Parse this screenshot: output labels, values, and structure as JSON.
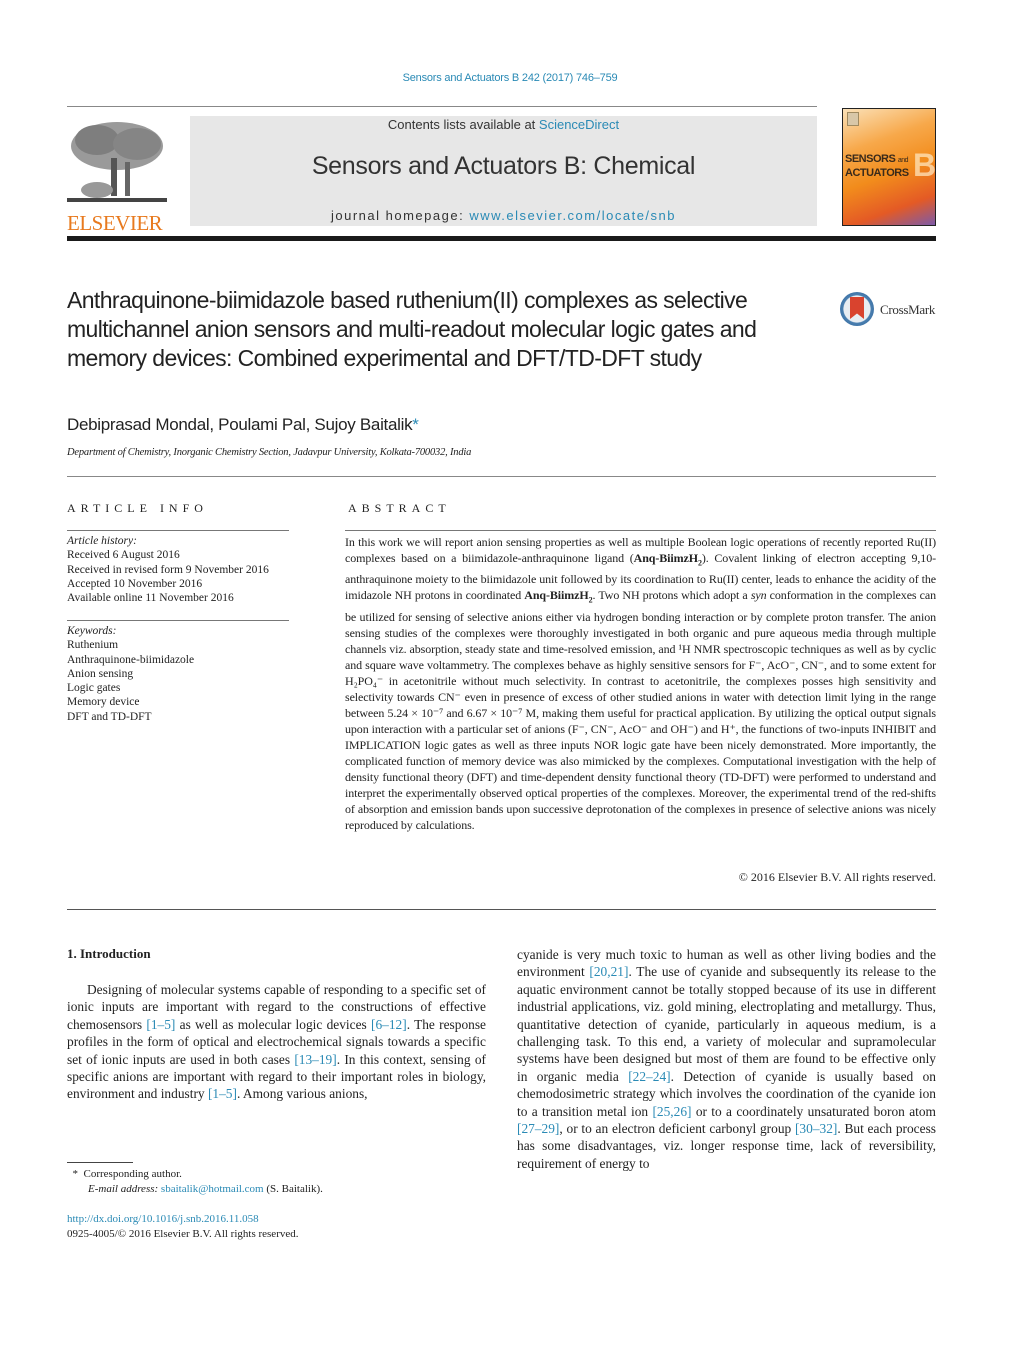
{
  "header": {
    "journal_ref": "Sensors and Actuators B 242 (2017) 746–759",
    "contents_prefix": "Contents lists available at ",
    "contents_link": "ScienceDirect",
    "journal_title": "Sensors and Actuators B: Chemical",
    "homepage_prefix": "journal homepage: ",
    "homepage_link": "www.elsevier.com/locate/snb",
    "publisher_logo_text": "ELSEVIER",
    "cover": {
      "line1": "SENSORS",
      "line1_small": "and",
      "line2": "ACTUATORS",
      "letter": "B"
    },
    "colors": {
      "link": "#2a8ab5",
      "elsevier_orange": "#e87a1f",
      "masthead_bg": "#e7e7e7"
    }
  },
  "article": {
    "title": "Anthraquinone-biimidazole based ruthenium(II) complexes as selective multichannel anion sensors and multi-readout molecular logic gates and memory devices: Combined experimental and DFT/TD-DFT study",
    "crossmark_label": "CrossMark",
    "authors": "Debiprasad Mondal, Poulami Pal, Sujoy Baitalik",
    "author_mark": "*",
    "affiliation": "Department of Chemistry, Inorganic Chemistry Section, Jadavpur University, Kolkata-700032, India"
  },
  "article_info": {
    "heading": "ARTICLE INFO",
    "history_label": "Article history:",
    "history": [
      "Received 6 August 2016",
      "Received in revised form 9 November 2016",
      "Accepted 10 November 2016",
      "Available online 11 November 2016"
    ],
    "keywords_label": "Keywords:",
    "keywords": [
      "Ruthenium",
      "Anthraquinone-biimidazole",
      "Anion sensing",
      "Logic gates",
      "Memory device",
      "DFT and TD-DFT"
    ]
  },
  "abstract": {
    "heading": "ABSTRACT",
    "p1": "In this work we will report anion sensing properties as well as multiple Boolean logic operations of recently reported Ru(II) complexes based on a biimidazole-anthraquinone ligand (",
    "ligand": "Anq-BiimzH",
    "ligand_sub": "2",
    "p2": "). Covalent linking of electron accepting 9,10-anthraquinone moiety to the biimidazole unit followed by its coordination to Ru(II) center, leads to enhance the acidity of the imidazole NH protons in coordinated ",
    "p3": ". Two NH protons which adopt a ",
    "syn": "syn",
    "p4": " conformation in the complexes can be utilized for sensing of selective anions either via hydrogen bonding interaction or by complete proton transfer. The anion sensing studies of the complexes were thoroughly investigated in both organic and pure aqueous media through multiple channels viz. absorption, steady state and time-resolved emission, and ¹H NMR spectroscopic techniques as well as by cyclic and square wave voltammetry. The complexes behave as highly sensitive sensors for F⁻, AcO⁻, CN⁻, and to some extent for H₂PO₄⁻ in acetonitrile without much selectivity. In contrast to acetonitrile, the complexes posses high sensitivity and selectivity towards CN⁻ even in presence of excess of other studied anions in water with detection limit lying in the range between 5.24 × 10⁻⁷ and 6.67 × 10⁻⁷ M, making them useful for practical application. By utilizing the optical output signals upon interaction with a particular set of anions (F⁻, CN⁻, AcO⁻ and OH⁻) and H⁺, the functions of two-inputs INHIBIT and IMPLICATION logic gates as well as three inputs NOR logic gate have been nicely demonstrated. More importantly, the complicated function of memory device was also mimicked by the complexes. Computational investigation with the help of density functional theory (DFT) and time-dependent density functional theory (TD-DFT) were performed to understand and interpret the experimentally observed optical properties of the complexes. Moreover, the experimental trend of the red-shifts of absorption and emission bands upon successive deprotonation of the complexes in presence of selective anions was nicely reproduced by calculations.",
    "copyright": "© 2016 Elsevier B.V. All rights reserved."
  },
  "intro": {
    "heading": "1.  Introduction",
    "left": [
      {
        "t": "Designing of molecular systems capable of responding to a specific set of ionic inputs are important with regard to the constructions of effective chemosensors "
      },
      {
        "ref": "[1–5]"
      },
      {
        "t": " as well as molecular logic devices "
      },
      {
        "ref": "[6–12]"
      },
      {
        "t": ". The response profiles in the form of optical and electrochemical signals towards a specific set of ionic inputs are used in both cases "
      },
      {
        "ref": "[13–19]"
      },
      {
        "t": ". In this context, sensing of specific anions are important with regard to their important roles in biology, environment and industry "
      },
      {
        "ref": "[1–5]"
      },
      {
        "t": ". Among various anions,"
      }
    ],
    "right": [
      {
        "t": "cyanide is very much toxic to human as well as other living bodies and the environment "
      },
      {
        "ref": "[20,21]"
      },
      {
        "t": ". The use of cyanide and subsequently its release to the aquatic environment cannot be totally stopped because of its use in different industrial applications, viz. gold mining, electroplating and metallurgy. Thus, quantitative detection of cyanide, particularly in aqueous medium, is a challenging task. To this end, a variety of molecular and supramolecular systems have been designed but most of them are found to be effective only in organic media "
      },
      {
        "ref": "[22–24]"
      },
      {
        "t": ". Detection of cyanide is usually based on chemodosimetric strategy which involves the coordination of the cyanide ion to a transition metal ion "
      },
      {
        "ref": "[25,26]"
      },
      {
        "t": " or to a coordinately unsaturated boron atom "
      },
      {
        "ref": "[27–29]"
      },
      {
        "t": ", or to an electron deficient carbonyl group "
      },
      {
        "ref": "[30–32]"
      },
      {
        "t": ". But each process has some disadvantages, viz. longer response time, lack of reversibility, requirement of energy to"
      }
    ]
  },
  "footnote": {
    "mark": "*",
    "corresponding": "Corresponding author.",
    "email_label": "E-mail address: ",
    "email": "sbaitalik@hotmail.com",
    "email_suffix": " (S. Baitalik).",
    "doi": "http://dx.doi.org/10.1016/j.snb.2016.11.058",
    "issn_line": "0925-4005/© 2016 Elsevier B.V. All rights reserved."
  }
}
